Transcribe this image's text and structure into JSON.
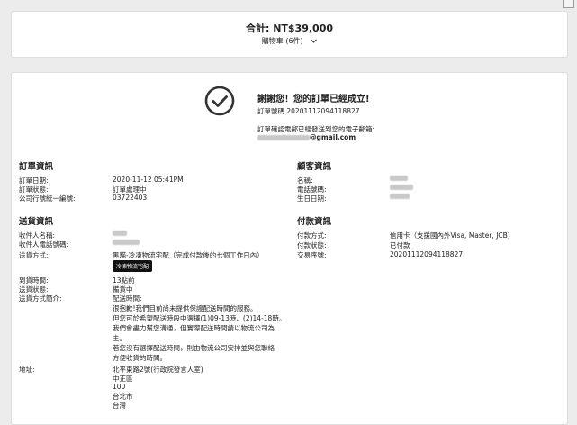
{
  "summary": {
    "total_label": "合計: NT$39,000",
    "cart_label": "購物車 (6件)"
  },
  "confirmation": {
    "title": "謝謝您！您的訂單已經成立!",
    "order_no": "訂單號碼 20201112094118827",
    "email_note": "訂單確認電郵已經發送到您的電子郵箱:",
    "email_suffix": "@gmail.com"
  },
  "order_info": {
    "heading": "訂單資訊",
    "rows": [
      {
        "label": "訂單日期:",
        "value": "2020-11-12 05:41PM"
      },
      {
        "label": "訂單狀態:",
        "value": "訂單處理中"
      },
      {
        "label": "公司行號統一編號:",
        "value": "03722403"
      }
    ]
  },
  "customer_info": {
    "heading": "顧客資訊",
    "rows": [
      {
        "label": "名稱:"
      },
      {
        "label": "電話號碼:"
      },
      {
        "label": "生日日期:"
      }
    ]
  },
  "delivery_info": {
    "heading": "送貨資訊",
    "recipient_label": "收件人名稱:",
    "phone_label": "收件人電話號碼:",
    "method_label": "送貨方式:",
    "method_value": "黑貓-冷凍物流宅配（完成付款後的七個工作日內）",
    "tooltip": "冷凍物流宅配",
    "time_label": "到貨時間:",
    "time_value": "13點前",
    "status_label": "送貨狀態:",
    "status_value": "備貨中",
    "desc_label": "送貨方式簡介:",
    "desc_lines": [
      "配送時間:",
      "很抱歉!我們目前尚未提供保證配送時間的服務。",
      "但您可於希望配送時段中選擇(1)09-13時、(2)14-18時。",
      "我們會盡力幫您溝通，但實際配送時間請以物流公司為",
      "主。",
      "若您沒有選擇配送時間，則由物流公司安排並與您聯絡",
      "方便收貨的時間。"
    ],
    "address_label": "地址:",
    "address_lines": [
      "北平東路2號(行政院發言人室)",
      "中正區",
      "100",
      "台北市",
      "台灣"
    ]
  },
  "payment_info": {
    "heading": "付款資訊",
    "rows": [
      {
        "label": "付款方式:",
        "value": "信用卡（支援國內外Visa, Master, JCB)"
      },
      {
        "label": "付款狀態:",
        "value": "已付款"
      },
      {
        "label": "交易序號:",
        "value": "20201112094118827"
      }
    ]
  }
}
